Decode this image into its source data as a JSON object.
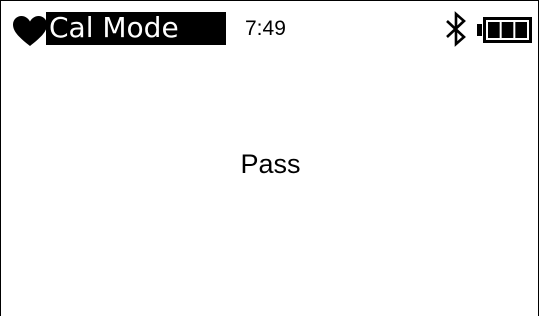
{
  "header": {
    "status_icon": "heart-icon",
    "mode_title": "Cal Mode",
    "time": "7:49",
    "bluetooth_icon": "bluetooth-icon",
    "battery_icon": "battery-icon",
    "battery_level_bars": 3,
    "battery_level_max": 3
  },
  "main": {
    "result_text": "Pass"
  }
}
